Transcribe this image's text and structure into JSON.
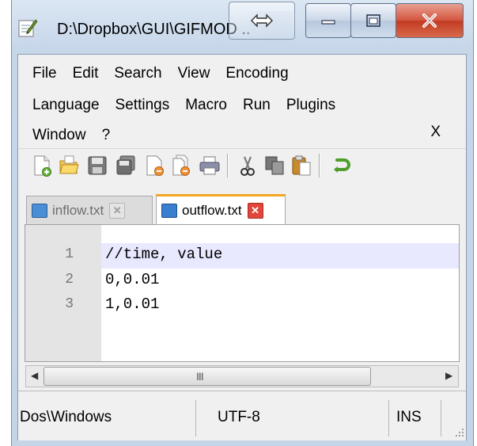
{
  "window": {
    "title": "D:\\Dropbox\\GUI\\GIFMOD ..",
    "controls": {
      "minimize": "minimize",
      "maximize": "maximize",
      "close": "close"
    }
  },
  "menu": {
    "rows": [
      [
        "File",
        "Edit",
        "Search",
        "View",
        "Encoding"
      ],
      [
        "Language",
        "Settings",
        "Macro",
        "Run",
        "Plugins"
      ],
      [
        "Window",
        "?"
      ]
    ],
    "close_label": "X"
  },
  "toolbar": {
    "buttons": [
      "new-file-icon",
      "open-file-icon",
      "save-icon",
      "save-all-icon",
      "close-icon",
      "close-all-icon",
      "print-icon",
      "cut-icon",
      "copy-icon",
      "paste-icon",
      "undo-icon"
    ]
  },
  "tabs": [
    {
      "label": "inflow.txt",
      "active": false
    },
    {
      "label": "outflow.txt",
      "active": true
    }
  ],
  "editor": {
    "lines": [
      {
        "num": "1",
        "text": "//time, value"
      },
      {
        "num": "2",
        "text": "0,0.01"
      },
      {
        "num": "3",
        "text": "1,0.01"
      }
    ]
  },
  "scrollbar": {
    "grip": "III"
  },
  "status": {
    "eol": "Dos\\Windows",
    "encoding": "UTF-8",
    "mode": "INS"
  },
  "colors": {
    "active_tab_accent": "#f5a623",
    "tab_close_red": "#e0473a",
    "current_line": "#e8e8ff"
  }
}
